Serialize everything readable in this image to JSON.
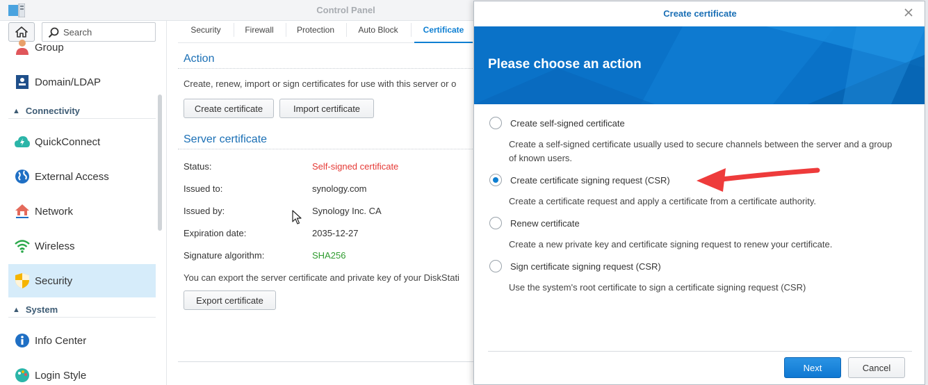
{
  "window": {
    "title": "Control Panel"
  },
  "sidebar": {
    "search_placeholder": "Search",
    "items": [
      {
        "label": "Group",
        "icon": "group-icon"
      },
      {
        "label": "Domain/LDAP",
        "icon": "domain-ldap-icon"
      },
      {
        "label": "QuickConnect",
        "icon": "quickconnect-icon"
      },
      {
        "label": "External Access",
        "icon": "globe-icon"
      },
      {
        "label": "Network",
        "icon": "network-house-icon"
      },
      {
        "label": "Wireless",
        "icon": "wifi-icon"
      },
      {
        "label": "Security",
        "icon": "shield-icon",
        "active": true
      },
      {
        "label": "Info Center",
        "icon": "info-icon"
      },
      {
        "label": "Login Style",
        "icon": "palette-icon"
      }
    ],
    "sections": {
      "connectivity": "Connectivity",
      "system": "System"
    }
  },
  "tabs": [
    "Security",
    "Firewall",
    "Protection",
    "Auto Block",
    "Certificate"
  ],
  "active_tab": "Certificate",
  "action": {
    "title": "Action",
    "description": "Create, renew, import or sign certificates for use with this server or o",
    "create_label": "Create certificate",
    "import_label": "Import certificate"
  },
  "server_certificate": {
    "title": "Server certificate",
    "rows": [
      {
        "label": "Status:",
        "value": "Self-signed certificate",
        "color": "#e53935"
      },
      {
        "label": "Issued to:",
        "value": "synology.com"
      },
      {
        "label": "Issued by:",
        "value": "Synology Inc. CA"
      },
      {
        "label": "Expiration date:",
        "value": "2035-12-27"
      },
      {
        "label": "Signature algorithm:",
        "value": "SHA256",
        "color": "#2e9b2e"
      }
    ],
    "export_text": "You can export the server certificate and private key of your DiskStati",
    "export_label": "Export certificate"
  },
  "dialog": {
    "title": "Create certificate",
    "banner_title": "Please choose an action",
    "options": [
      {
        "label": "Create self-signed certificate",
        "description": "Create a self-signed certificate usually used to secure channels between the server and a group of known users.",
        "selected": false
      },
      {
        "label": "Create certificate signing request (CSR)",
        "description": "Create a certificate request and apply a certificate from a certificate authority.",
        "selected": true
      },
      {
        "label": "Renew certificate",
        "description": "Create a new private key and certificate signing request to renew your certificate.",
        "selected": false
      },
      {
        "label": "Sign certificate signing request (CSR)",
        "description": "Use the system's root certificate to sign a certificate signing request (CSR)",
        "selected": false
      }
    ],
    "next_label": "Next",
    "cancel_label": "Cancel"
  },
  "colors": {
    "accent": "#0e7fd2",
    "banner": "#0a72c8",
    "annotation_arrow": "#ee3b3b"
  }
}
